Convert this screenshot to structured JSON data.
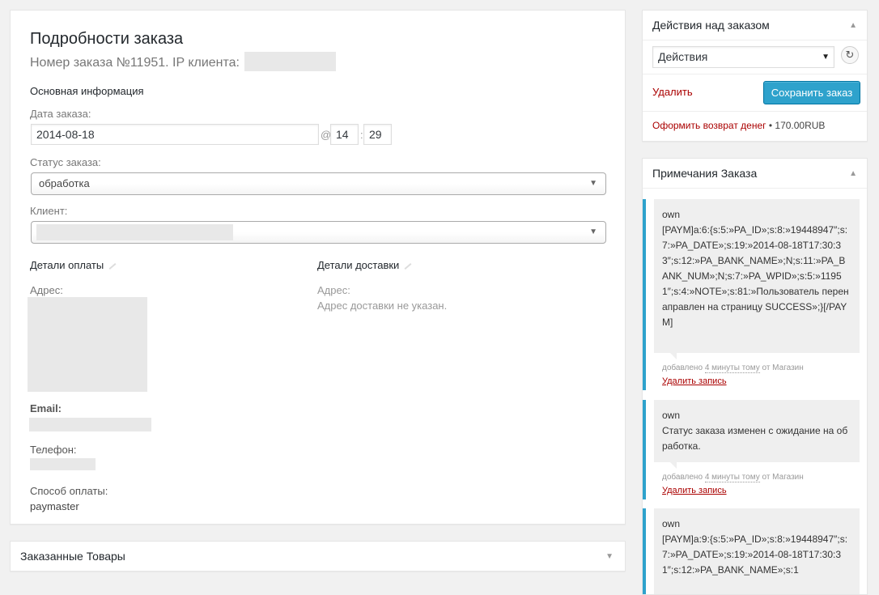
{
  "order": {
    "title": "Подробности заказа",
    "subtitle": "Номер заказа №11951. IP клиента:",
    "general_heading": "Основная информация",
    "date_label": "Дата заказа:",
    "date_value": "2014-08-18",
    "at_sign": "@",
    "hour": "14",
    "colon": ":",
    "minute": "29",
    "status_label": "Статус заказа:",
    "status_value": "обработка",
    "client_label": "Клиент:",
    "billing_heading": "Детали оплаты",
    "shipping_heading": "Детали доставки",
    "billing_address_label": "Адрес:",
    "shipping_address_label": "Адрес:",
    "shipping_address_value": "Адрес доставки не указан.",
    "email_label": "Email:",
    "phone_label": "Телефон:",
    "payment_method_label": "Способ оплаты:",
    "payment_method_value": "paymaster"
  },
  "items_box": {
    "title": "Заказанные Товары",
    "toggle": "▼"
  },
  "actions_box": {
    "title": "Действия над заказом",
    "toggle": "▲",
    "select_value": "Действия",
    "select_arrow": "▼",
    "refresh_icon": "↻",
    "delete_link": "Удалить",
    "save_button": "Сохранить заказ",
    "refund_link": "Оформить возврат денег",
    "refund_amount": "• 170.00RUB"
  },
  "notes_box": {
    "title": "Примечания Заказа",
    "toggle": "▲",
    "notes": [
      {
        "author": "own",
        "text": "[PAYM]a:6:{s:5:»PA_ID»;s:8:»19448947″;s:7:»PA_DATE»;s:19:»2014-08-18T17:30:33″;s:12:»PA_BANK_NAME»;N;s:11:»PA_BANK_NUM»;N;s:7:»PA_WPID»;s:5:»11951″;s:4:»NOTE»;s:81:»Пользователь перенаправлен на страницу SUCCESS»;}[/PAYM]",
        "added_prefix": "добавлено",
        "added_time": "4 минуты тому",
        "added_suffix": "от Магазин",
        "delete": "Удалить запись"
      },
      {
        "author": "own",
        "text": "Статус заказа изменен с ожидание на обработка.",
        "added_prefix": "добавлено",
        "added_time": "4 минуты тому",
        "added_suffix": "от Магазин",
        "delete": "Удалить запись"
      },
      {
        "author": "own",
        "text": "[PAYM]a:9:{s:5:»PA_ID»;s:8:»19448947″;s:7:»PA_DATE»;s:19:»2014-08-18T17:30:31″;s:12:»PA_BANK_NAME»;s:1"
      }
    ]
  },
  "colors": {
    "accent": "#2ea2cc",
    "link_red": "#a00000",
    "note_bg": "#efefef",
    "page_bg": "#f1f1f1"
  }
}
